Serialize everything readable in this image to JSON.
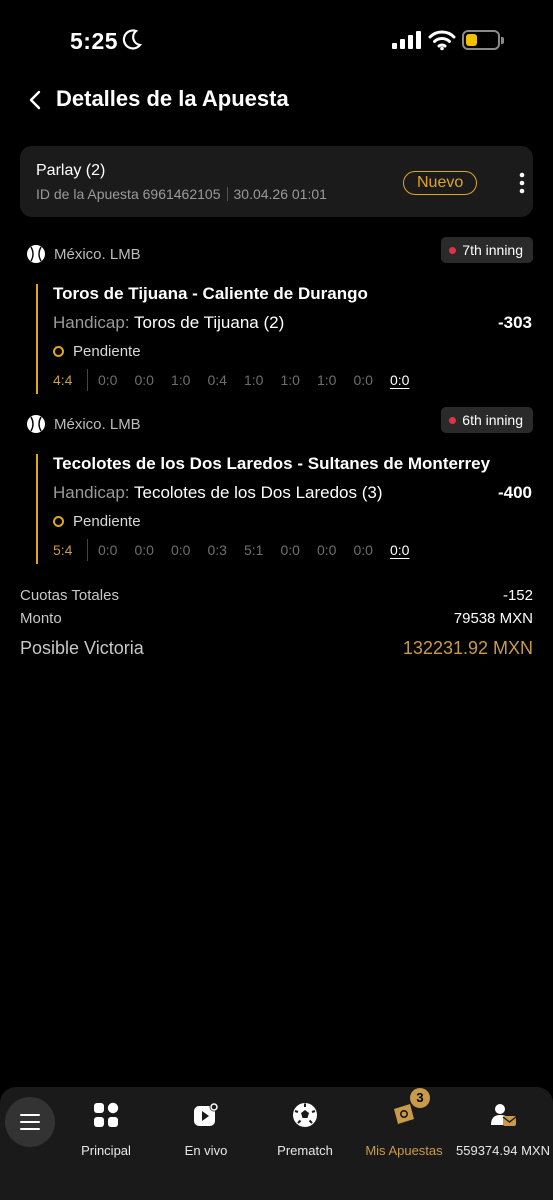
{
  "status_bar": {
    "time": "5:25"
  },
  "header": {
    "title": "Detalles de la Apuesta"
  },
  "bet": {
    "type": "Parlay (2)",
    "id_label": "ID de la Apuesta 6961462105",
    "datetime": "30.04.26 01:01",
    "badge": "Nuevo"
  },
  "events": [
    {
      "league": "México. LMB",
      "inning": "7th inning",
      "match": "Toros de Tijuana - Caliente de Durango",
      "handicap_label": "Handicap:",
      "handicap_value": "Toros de Tijuana (2)",
      "odds": "-303",
      "status": "Pendiente",
      "total": "4:4",
      "innings": [
        "0:0",
        "0:0",
        "1:0",
        "0:4",
        "1:0",
        "1:0",
        "1:0",
        "0:0",
        "0:0"
      ]
    },
    {
      "league": "México. LMB",
      "inning": "6th inning",
      "match": "Tecolotes de los Dos Laredos - Sultanes de Monterrey",
      "handicap_label": "Handicap:",
      "handicap_value": "Tecolotes de los Dos Laredos (3)",
      "odds": "-400",
      "status": "Pendiente",
      "total": "5:4",
      "innings": [
        "0:0",
        "0:0",
        "0:0",
        "0:3",
        "5:1",
        "0:0",
        "0:0",
        "0:0",
        "0:0"
      ]
    }
  ],
  "totals": {
    "odds_label": "Cuotas Totales",
    "odds_value": "-152",
    "amount_label": "Monto",
    "amount_value": "79538 MXN",
    "win_label": "Posible Victoria",
    "win_value": "132231.92 MXN"
  },
  "nav": {
    "items": [
      {
        "label": "Principal",
        "icon": "grid-icon"
      },
      {
        "label": "En vivo",
        "icon": "live-play-icon"
      },
      {
        "label": "Prematch",
        "icon": "soccer-ball-icon"
      },
      {
        "label": "Mis Apuestas",
        "icon": "ticket-icon",
        "badge": "3"
      },
      {
        "label": "559374.94 MXN",
        "icon": "account-wallet-icon"
      }
    ]
  },
  "colors": {
    "accent": "#e0a520",
    "gold_text": "#c89a4a",
    "live_dot": "#e0314a",
    "card_bg": "#1b1b1b"
  }
}
